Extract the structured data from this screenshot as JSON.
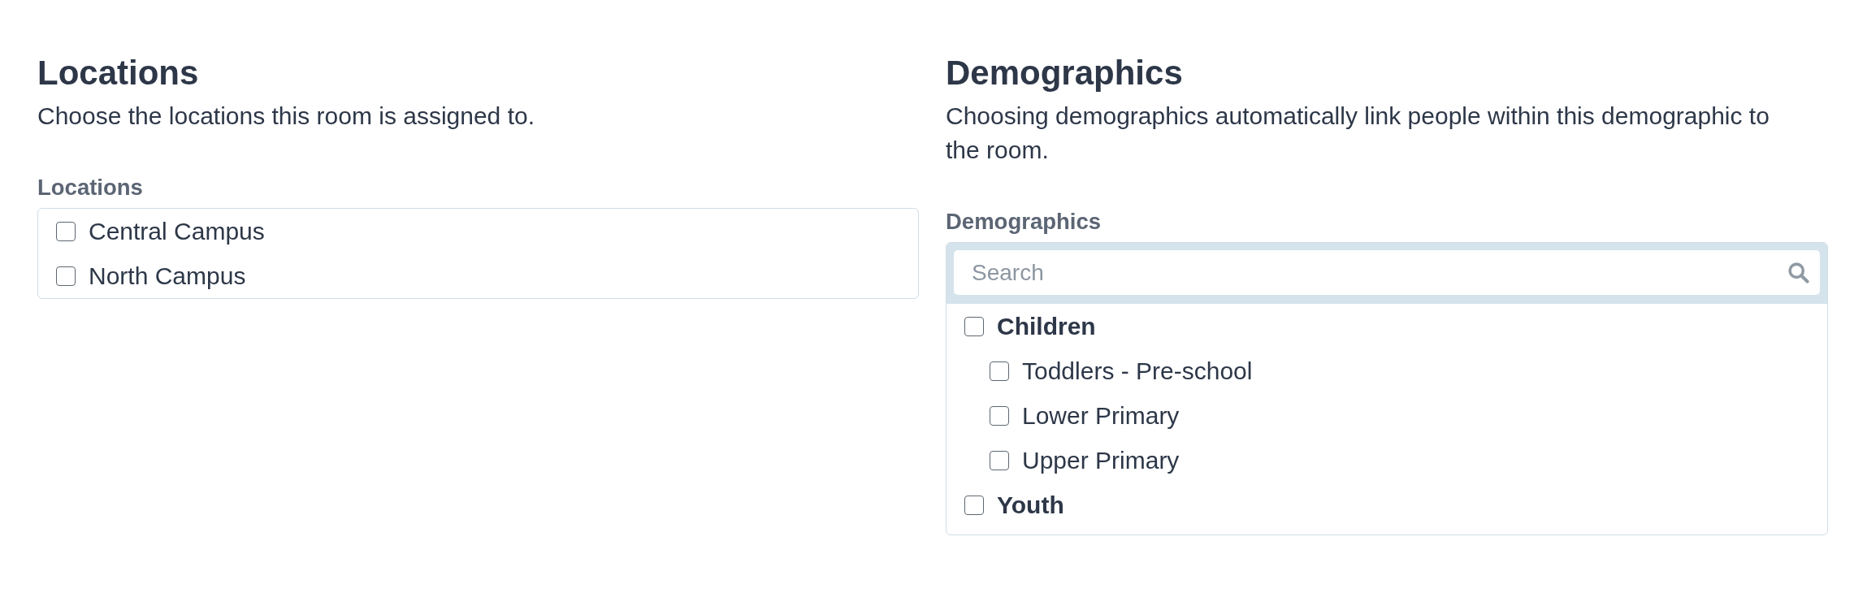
{
  "sections": [
    {
      "kind": "checklist",
      "title": "Locations",
      "description": "Choose the locations this room is assigned to.",
      "field_label": "Locations",
      "options": [
        {
          "label": "Central Campus",
          "checked": false
        },
        {
          "label": "North Campus",
          "checked": false
        }
      ]
    },
    {
      "kind": "tree",
      "title": "Demographics",
      "description": "Choosing demographics automatically link people within this demographic to the room.",
      "field_label": "Demographics",
      "search": {
        "placeholder": "Search"
      },
      "options": [
        {
          "label": "Children",
          "checked": false,
          "children": [
            {
              "label": "Toddlers - Pre-school",
              "checked": false
            },
            {
              "label": "Lower Primary",
              "checked": false
            },
            {
              "label": "Upper Primary",
              "checked": false
            }
          ]
        },
        {
          "label": "Youth",
          "checked": false
        }
      ]
    }
  ]
}
